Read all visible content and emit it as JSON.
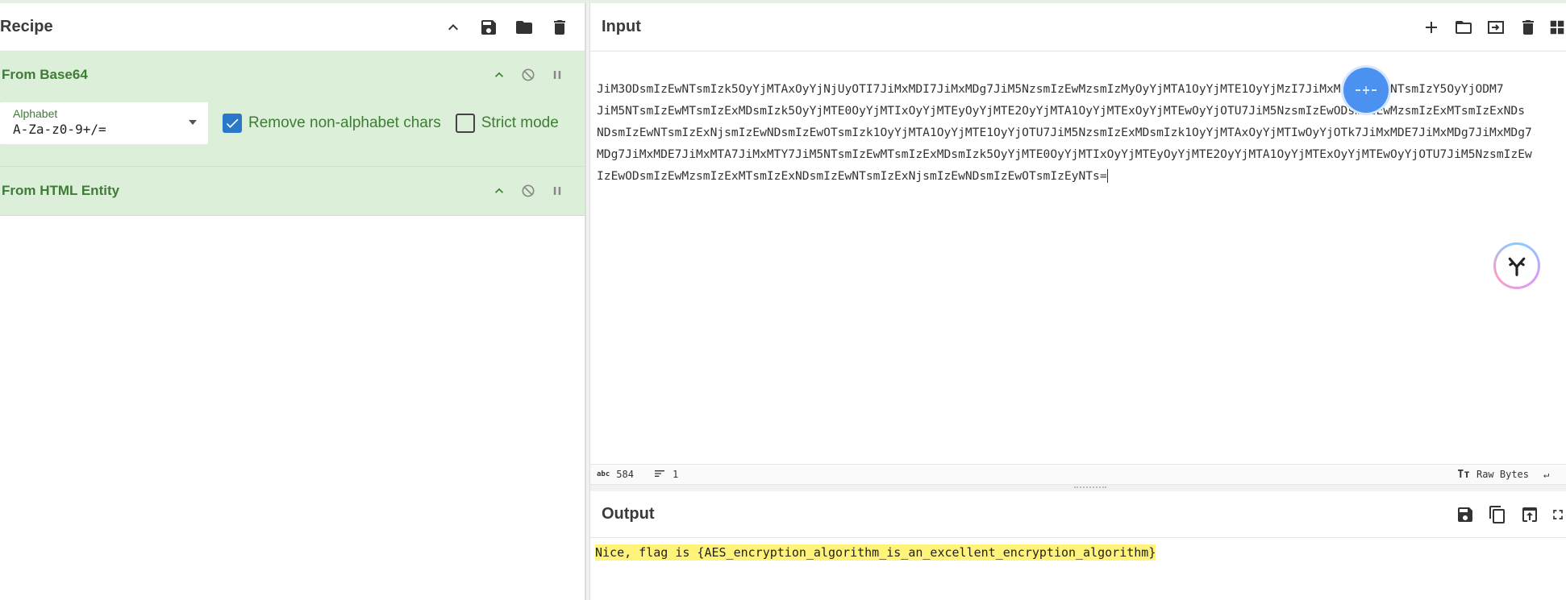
{
  "recipe": {
    "title": "Recipe",
    "operations": [
      {
        "title": "From Base64",
        "args": {
          "alphabet_label": "Alphabet",
          "alphabet_value": "A-Za-z0-9+/=",
          "remove_label": "Remove non-alphabet chars",
          "remove_checked": true,
          "strict_label": "Strict mode",
          "strict_checked": false
        }
      },
      {
        "title": "From HTML Entity"
      }
    ]
  },
  "input": {
    "title": "Input",
    "lines": [
      "JiM3ODsmIzEwNTsmIzk5OyYjMTAxOyYjNjUyOTI7JiMxMDI7JiMxMDg7JiM5NzsmIzEwMzsmIzMyOyYjMTA1OyYjMTE1OyYjMzI7JiMxMjM7JiM2NTsmIzY5OyYjODM7",
      "JiM5NTsmIzEwMTsmIzExMDsmIzk5OyYjMTE0OyYjMTIxOyYjMTEyOyYjMTE2OyYjMTA1OyYjMTExOyYjMTEwOyYjOTU7JiM5NzsmIzEwODsmIzEwMzsmIzExMTsmIzExNDs",
      "NDsmIzEwNTsmIzExNjsmIzEwNDsmIzEwOTsmIzk1OyYjMTA1OyYjMTE1OyYjOTU7JiM5NzsmIzExMDsmIzk1OyYjMTAxOyYjMTIwOyYjOTk7JiMxMDE7JiMxMDg7JiMxMDg7",
      "MDg7JiMxMDE7JiMxMTA7JiMxMTY7JiM5NTsmIzEwMTsmIzExMDsmIzk5OyYjMTE0OyYjMTIxOyYjMTEyOyYjMTE2OyYjMTA1OyYjMTExOyYjMTEwOyYjOTU7JiM5NzsmIzEw",
      "IzEwODsmIzEwMzsmIzExMTsmIzExNDsmIzEwNTsmIzExNjsmIzEwNDsmIzEwOTsmIzEyNTs="
    ],
    "status_length": "584",
    "status_lines": "1",
    "encoding": "Raw Bytes"
  },
  "output": {
    "title": "Output",
    "text": "Nice, flag is {AES_encryption_algorithm_is_an_excellent_encryption_algorithm}"
  }
}
